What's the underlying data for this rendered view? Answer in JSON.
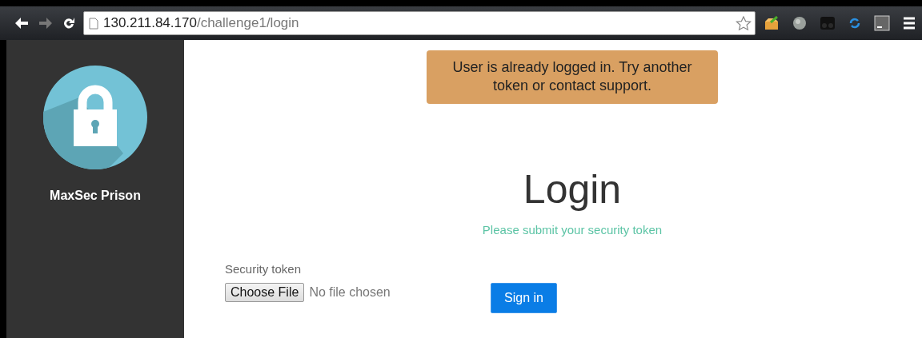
{
  "browser": {
    "url_host": "130.211.84.170",
    "url_path": "/challenge1/login",
    "bookmarked": false
  },
  "sidebar": {
    "brand": "MaxSec Prison"
  },
  "alert": {
    "message": "User is already logged in. Try another token or contact support."
  },
  "login": {
    "title": "Login",
    "subtitle": "Please submit your security token",
    "field_label": "Security token",
    "file_button": "Choose File",
    "file_status": "No file chosen",
    "submit": "Sign in"
  }
}
